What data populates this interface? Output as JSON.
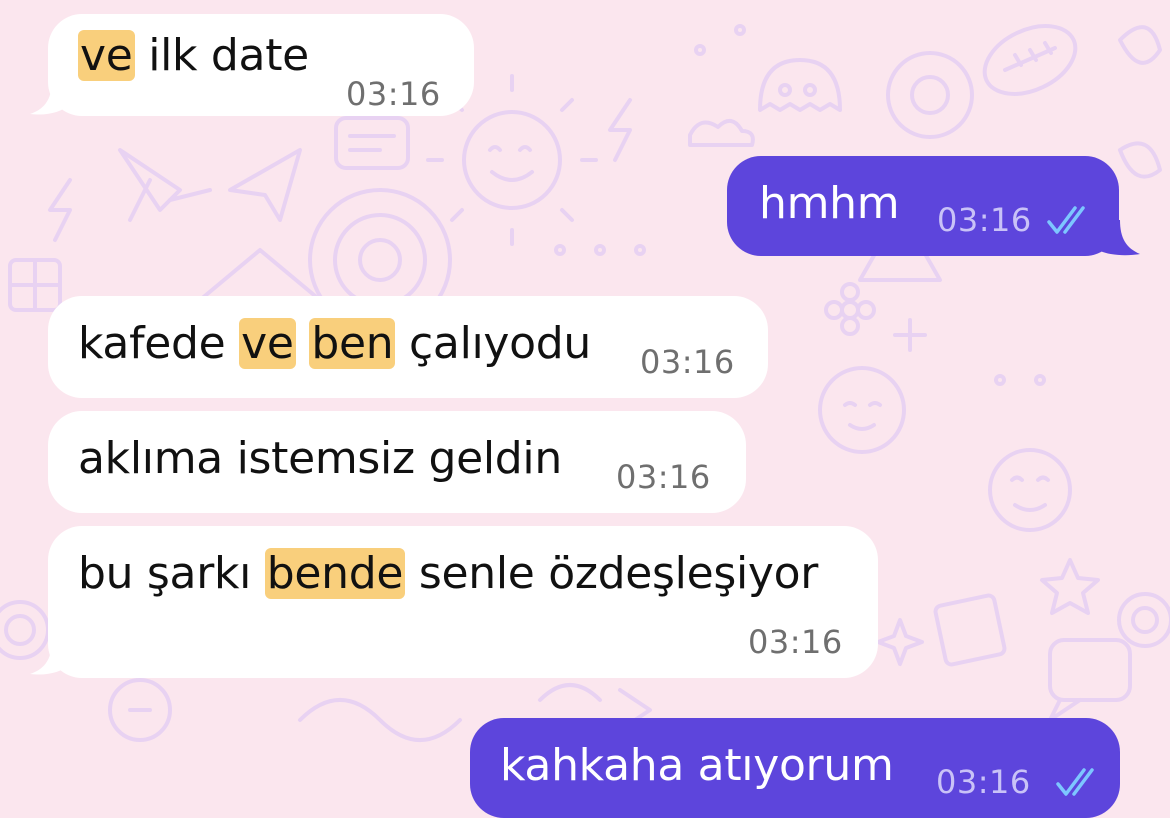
{
  "theme": {
    "incoming_bg": "#ffffff",
    "outgoing_bg": "#5d45dc",
    "highlight": "#f9cf7c",
    "wallpaper_bg": "#fbe6ee",
    "doodle_stroke": "#e4cdf0"
  },
  "messages": [
    {
      "direction": "incoming",
      "parts": [
        {
          "t": "ve",
          "hl": true
        },
        {
          "t": " ilk date",
          "hl": false
        }
      ],
      "time": "03:16"
    },
    {
      "direction": "outgoing",
      "text": "hmhm",
      "time": "03:16",
      "status_icon": "double-check-read-icon"
    },
    {
      "direction": "incoming",
      "parts": [
        {
          "t": "kafede ",
          "hl": false
        },
        {
          "t": "ve",
          "hl": true
        },
        {
          "t": " ",
          "hl": false
        },
        {
          "t": "ben",
          "hl": true
        },
        {
          "t": " çalıyodu",
          "hl": false
        }
      ],
      "time": "03:16"
    },
    {
      "direction": "incoming",
      "parts": [
        {
          "t": "aklıma istemsiz geldin",
          "hl": false
        }
      ],
      "time": "03:16"
    },
    {
      "direction": "incoming",
      "parts": [
        {
          "t": "bu şarkı ",
          "hl": false
        },
        {
          "t": "bende",
          "hl": true
        },
        {
          "t": " senle özdeşleşiyor",
          "hl": false
        }
      ],
      "time": "03:16"
    },
    {
      "direction": "outgoing",
      "text": "kahkaha atıyorum",
      "time": "03:16",
      "status_icon": "double-check-read-icon"
    }
  ]
}
